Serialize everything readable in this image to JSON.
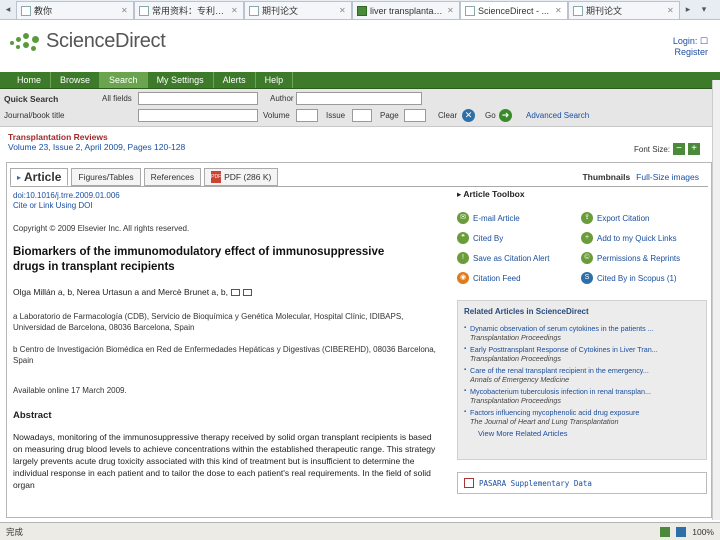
{
  "browser": {
    "tabs": [
      {
        "label": "教你"
      },
      {
        "label": "常用资料：专利检索"
      },
      {
        "label": "期刊论文"
      },
      {
        "label": "liver transplantation..."
      },
      {
        "label": "ScienceDirect - ..."
      },
      {
        "label": "期刊论文"
      }
    ]
  },
  "header": {
    "logo_text": "ScienceDirect",
    "login": "Login: ☐",
    "register": "Register"
  },
  "nav": {
    "items": [
      "Home",
      "Browse",
      "Search",
      "My Settings",
      "Alerts",
      "Help"
    ]
  },
  "quick_search": {
    "label": "Quick Search",
    "all_fields": "All fields",
    "author": "Author",
    "journal_label": "Journal/book title",
    "volume": "Volume",
    "issue": "Issue",
    "page": "Page",
    "clear": "Clear",
    "go": "Go",
    "advanced": "Advanced Search"
  },
  "journal": {
    "title": "Transplantation Reviews",
    "volume_line": "Volume 23, Issue 2, April 2009, Pages 120-128",
    "font_size_label": "Font Size:"
  },
  "article_tabs": {
    "article": "Article",
    "figures": "Figures/Tables",
    "references": "References",
    "pdf": "PDF (286 K)",
    "thumbnails": "Thumbnails",
    "fullsize": "Full-Size images"
  },
  "article": {
    "doi": "doi:10.1016/j.trre.2009.01.006",
    "cite": "Cite or Link Using DOI",
    "copyright": "Copyright © 2009 Elsevier Inc. All rights reserved.",
    "title_line1": "Biomarkers of the immunomodulatory effect of immunosuppressive",
    "title_line2": "drugs in transplant recipients",
    "authors": "Olga Millán a, b, Nerea Urtasun a and Mercè Brunet a, b,",
    "affil_a": "a Laboratorio de Farmacología (CDB), Servicio de Bioquímica y Genética Molecular, Hospital Clínic, IDIBAPS, Universidad de Barcelona, 08036 Barcelona, Spain",
    "affil_b": "b Centro de Investigación Biomédica en Red de Enfermedades Hepáticas y Digestivas (CIBEREHD), 08036 Barcelona, Spain",
    "available": "Available online 17 March 2009.",
    "abstract_heading": "Abstract",
    "abstract_text": "Nowadays, monitoring of the immunosuppressive therapy received by solid organ transplant recipients is based on measuring drug blood levels to achieve concentrations within the established therapeutic range. This strategy largely prevents acute drug toxicity associated with this kind of treatment but is insufficient to determine the individual response in each patient and to tailor the dose to each patient's real requirements. In the field of solid organ"
  },
  "toolbox": {
    "heading": "Article Toolbox",
    "items": [
      {
        "label": "E-mail Article",
        "icon": "email-icon"
      },
      {
        "label": "Export Citation",
        "icon": "export-icon"
      },
      {
        "label": "Cited By",
        "icon": "cited-icon"
      },
      {
        "label": "Add to my Quick Links",
        "icon": "quicklinks-icon"
      },
      {
        "label": "Save as Citation Alert",
        "icon": "alert-icon"
      },
      {
        "label": "Permissions & Reprints",
        "icon": "permissions-icon"
      },
      {
        "label": "Citation Feed",
        "icon": "feed-icon"
      },
      {
        "label": "Cited By in Scopus (1)",
        "icon": "scopus-icon"
      }
    ]
  },
  "related": {
    "heading": "Related Articles in ScienceDirect",
    "items": [
      {
        "title": "Dynamic observation of serum cytokines in the patients ...",
        "source": "Transplantation Proceedings"
      },
      {
        "title": "Early Posttransplant Response of Cytokines in Liver Tran...",
        "source": "Transplantation Proceedings"
      },
      {
        "title": "Care of the renal transplant recipient in the emergency...",
        "source": "Annals of Emergency Medicine"
      },
      {
        "title": "Mycobacterium tuberculosis infection in renal transplan...",
        "source": "Transplantation Proceedings"
      },
      {
        "title": "Factors influencing mycophenolic acid drug exposure",
        "source": "The Journal of Heart and Lung Transplantation"
      }
    ],
    "view_more": "View More Related Articles"
  },
  "supplementary": {
    "label": "PASARA Supplementary Data"
  },
  "status": {
    "text": "完成",
    "zoom": "100%"
  }
}
